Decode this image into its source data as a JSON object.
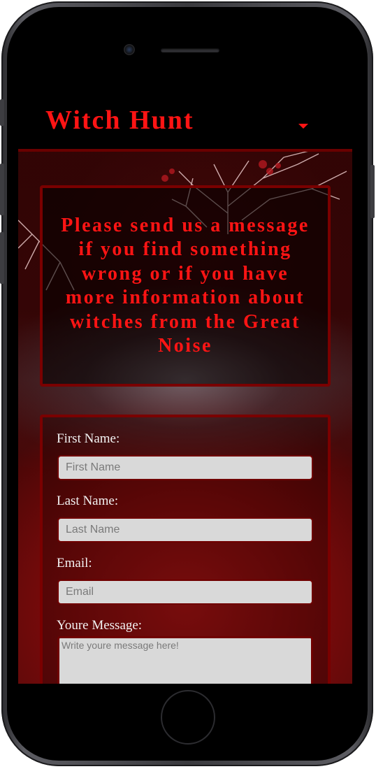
{
  "nav": {
    "brand": "Witch Hunt",
    "toggle_icon": "caret-down-icon"
  },
  "message_box": {
    "text": "Please send us a message if you find something wrong or if you have more information about witches from the Great Noise"
  },
  "form": {
    "first_name": {
      "label": "First Name:",
      "placeholder": "First Name",
      "value": ""
    },
    "last_name": {
      "label": "Last Name:",
      "placeholder": "Last Name",
      "value": ""
    },
    "email": {
      "label": "Email:",
      "placeholder": "Email",
      "value": ""
    },
    "message": {
      "label": "Youre Message:",
      "placeholder": "Write youre message here!",
      "value": ""
    }
  },
  "colors": {
    "accent_red": "#ff1414",
    "border_dark_red": "#7a0000",
    "input_bg": "#d9d9d9"
  }
}
